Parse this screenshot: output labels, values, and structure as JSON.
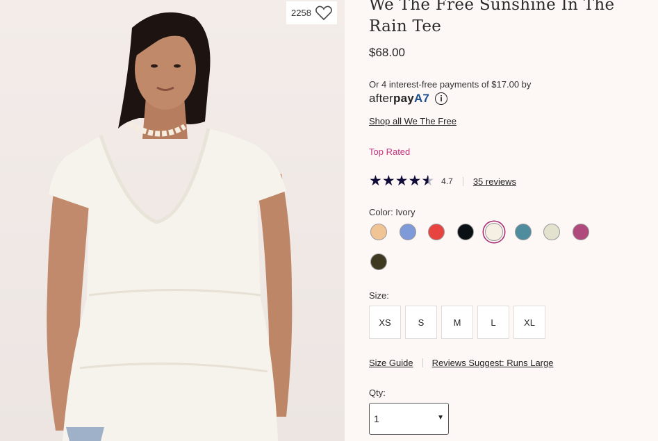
{
  "product": {
    "title": "We The Free Sunshine In The Rain Tee",
    "price": "$68.00",
    "favorites_count": "2258"
  },
  "afterpay": {
    "text": "Or 4 interest-free payments of $17.00 by",
    "logo_regular": "after",
    "logo_bold": "pay",
    "logo_mark": "A7"
  },
  "brand_link": "Shop all We The Free",
  "badge": "Top Rated",
  "rating": {
    "value": "4.7",
    "stars": 4.7,
    "reviews_label": "35 reviews"
  },
  "color": {
    "label": "Color: Ivory",
    "swatches": [
      {
        "name": "peach",
        "hex": "#f1c496"
      },
      {
        "name": "periwinkle",
        "hex": "#7e9ad8"
      },
      {
        "name": "red",
        "hex": "#e8443f"
      },
      {
        "name": "black",
        "hex": "#0b1014"
      },
      {
        "name": "ivory",
        "hex": "#f5f0e3",
        "selected": true
      },
      {
        "name": "teal",
        "hex": "#4f8d9e"
      },
      {
        "name": "sage",
        "hex": "#e2e2cf"
      },
      {
        "name": "berry",
        "hex": "#b04a7d"
      },
      {
        "name": "olive",
        "hex": "#3e3a22"
      }
    ]
  },
  "size": {
    "label": "Size:",
    "options": [
      "XS",
      "S",
      "M",
      "L",
      "XL"
    ],
    "guide_link": "Size Guide",
    "fit_link": "Reviews Suggest: Runs Large"
  },
  "quantity": {
    "label": "Qty:",
    "value": "1"
  },
  "colors": {
    "accent": "#c2377f",
    "star": "#0f0c3a",
    "background": "#fdf7f6"
  }
}
